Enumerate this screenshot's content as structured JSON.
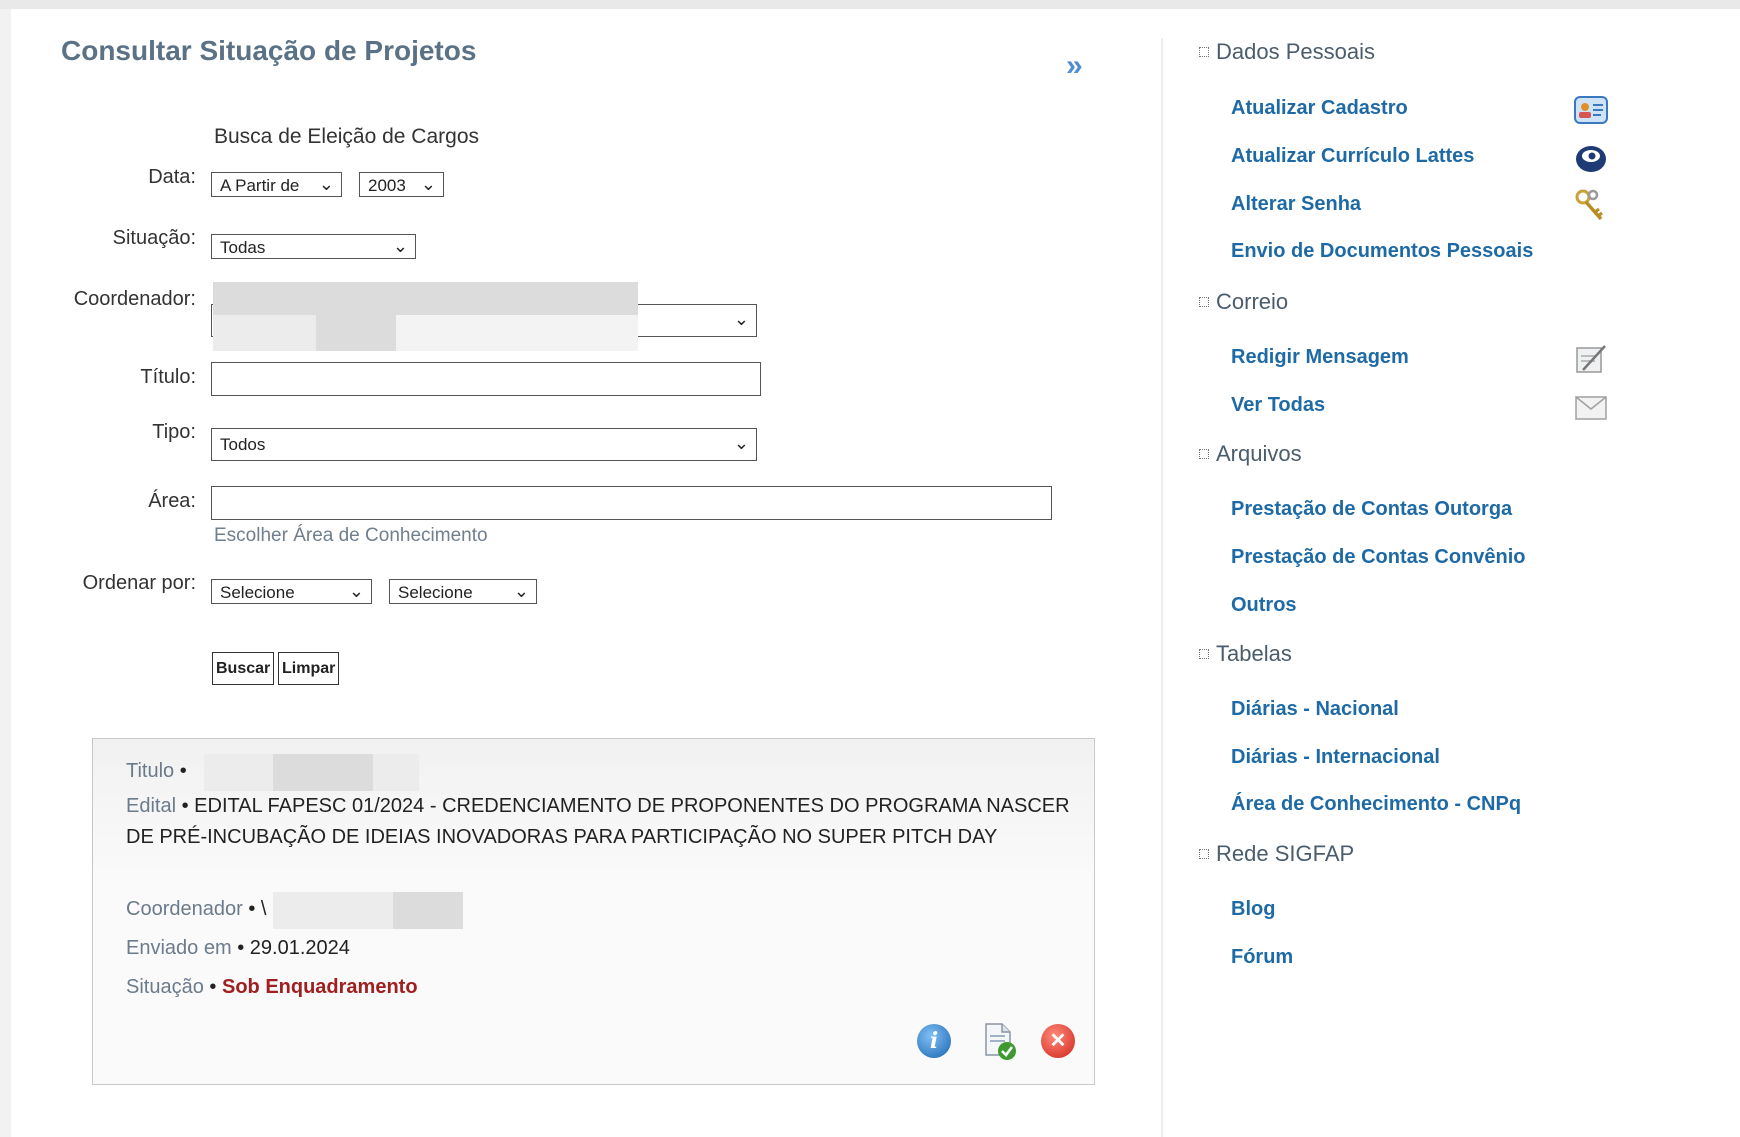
{
  "page": {
    "title": "Consultar Situação de Projetos",
    "collapse_glyph": "»"
  },
  "form": {
    "section_title": "Busca de Eleição de Cargos",
    "data_label": "Data:",
    "data_mode_value": "A Partir de",
    "data_year_value": "2003",
    "situacao_label": "Situação:",
    "situacao_value": "Todas",
    "coordenador_label": "Coordenador:",
    "titulo_label": "Título:",
    "titulo_value": "",
    "tipo_label": "Tipo:",
    "tipo_value": "Todos",
    "area_label": "Área:",
    "area_value": "",
    "area_link": "Escolher Área de Conhecimento",
    "ordenar_label": "Ordenar por:",
    "ordenar_value_1": "Selecione",
    "ordenar_value_2": "Selecione",
    "buscar_label": "Buscar",
    "limpar_label": "Limpar"
  },
  "result": {
    "titulo_label": "Titulo",
    "edital_label": "Edital",
    "edital_value": "EDITAL FAPESC 01/2024 - CREDENCIAMENTO DE PROPONENTES DO PROGRAMA NASCER DE PRÉ-INCUBAÇÃO DE IDEIAS INOVADORAS PARA PARTICIPAÇÃO NO SUPER PITCH DAY",
    "coordenador_label": "Coordenador",
    "coordenador_fragment": "\\",
    "enviado_label": "Enviado em",
    "enviado_value": "29.01.2024",
    "situacao_label": "Situação",
    "situacao_value": "Sob Enquadramento",
    "separator": "•"
  },
  "sidebar": {
    "sections": [
      {
        "title": "Dados Pessoais",
        "items": [
          "Atualizar Cadastro",
          "Atualizar Currículo Lattes",
          "Alterar Senha",
          "Envio de Documentos Pessoais"
        ]
      },
      {
        "title": "Correio",
        "items": [
          "Redigir Mensagem",
          "Ver Todas"
        ]
      },
      {
        "title": "Arquivos",
        "items": [
          "Prestação de Contas Outorga",
          "Prestação de Contas Convênio",
          "Outros"
        ]
      },
      {
        "title": "Tabelas",
        "items": [
          "Diárias - Nacional",
          "Diárias - Internacional",
          "Área de Conhecimento - CNPq"
        ]
      },
      {
        "title": "Rede SIGFAP",
        "items": [
          "Blog",
          "Fórum"
        ]
      }
    ]
  },
  "colors": {
    "title": "#5b7286",
    "link": "#1e6aa6",
    "status": "#a02020",
    "muted_label": "#6b7b8b"
  },
  "icons": {
    "collapse": "double-chevron-right-icon",
    "info": "info-icon",
    "document_check": "document-check-icon",
    "delete": "close-icon",
    "cadastro": "id-card-icon",
    "lattes": "lattes-icon",
    "senha": "keys-icon",
    "mensagem": "compose-icon",
    "ver_todas": "envelope-icon"
  }
}
